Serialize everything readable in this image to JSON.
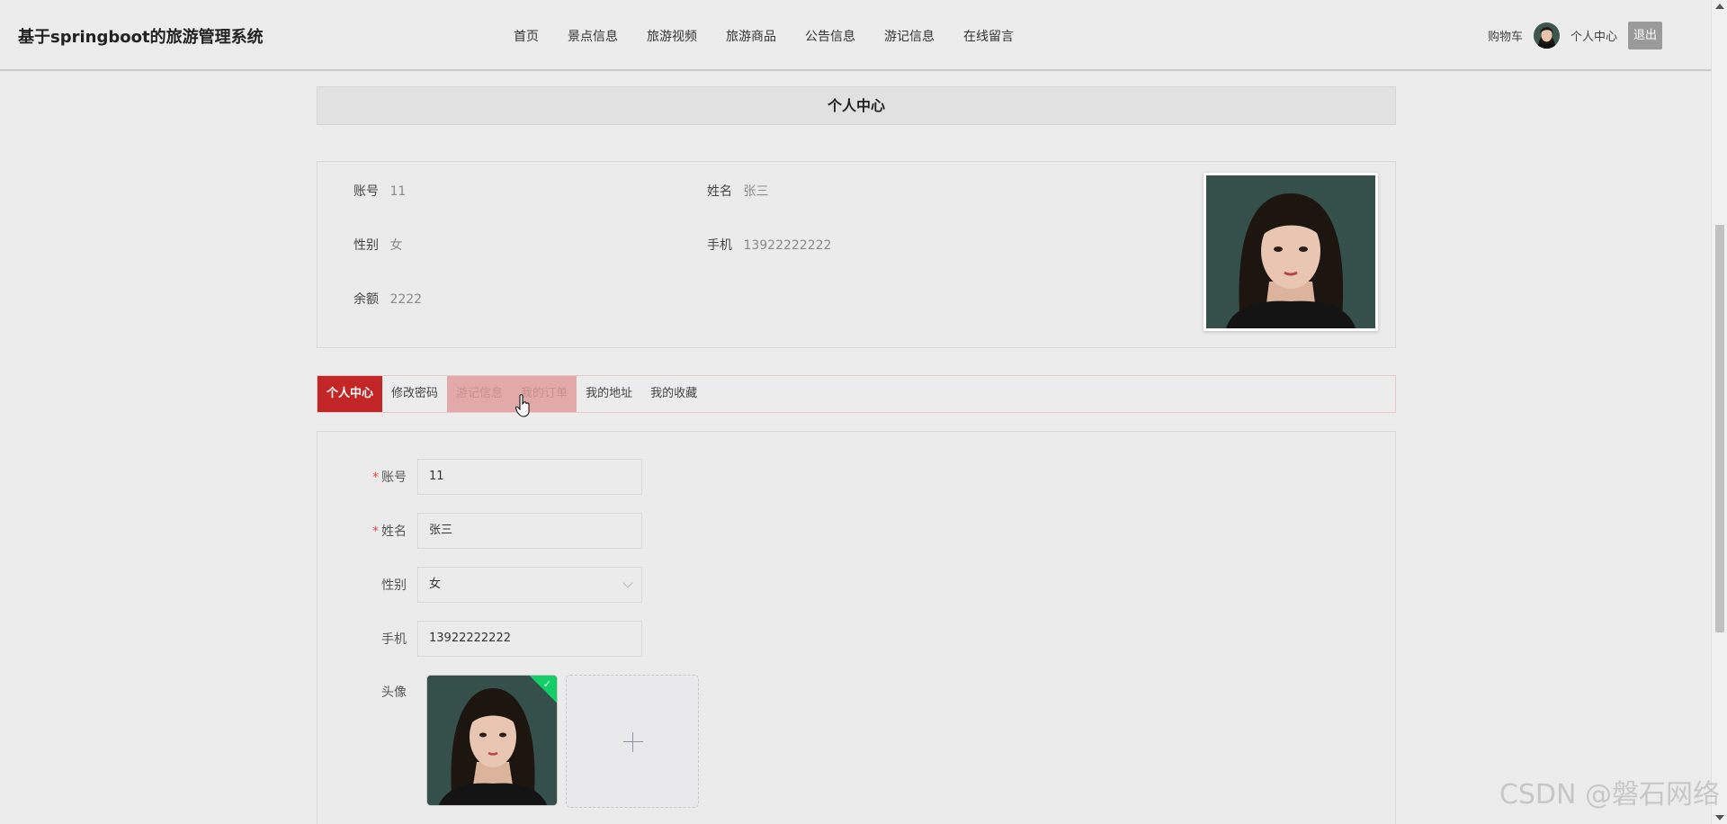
{
  "header": {
    "brand": "基于springboot的旅游管理系统",
    "nav": [
      "首页",
      "景点信息",
      "旅游视频",
      "旅游商品",
      "公告信息",
      "游记信息",
      "在线留言"
    ],
    "cart": "购物车",
    "user_center": "个人中心",
    "logout": "退出"
  },
  "page_title": "个人中心",
  "profile": {
    "account_label": "账号",
    "account_value": "11",
    "name_label": "姓名",
    "name_value": "张三",
    "gender_label": "性别",
    "gender_value": "女",
    "phone_label": "手机",
    "phone_value": "13922222222",
    "balance_label": "余额",
    "balance_value": "2222"
  },
  "tabs": [
    "个人中心",
    "修改密码",
    "游记信息",
    "我的订单",
    "我的地址",
    "我的收藏"
  ],
  "form": {
    "account_label": "账号",
    "account_value": "11",
    "name_label": "姓名",
    "name_value": "张三",
    "gender_label": "性别",
    "gender_value": "女",
    "phone_label": "手机",
    "phone_value": "13922222222",
    "avatar_label": "头像"
  },
  "watermark": "CSDN @磐石网络",
  "colors": {
    "accent": "#c32626",
    "success": "#13ce66"
  }
}
